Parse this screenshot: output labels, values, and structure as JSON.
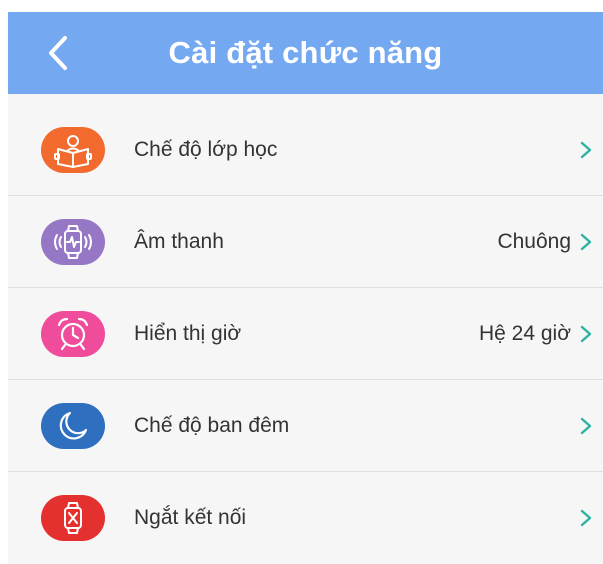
{
  "header": {
    "title": "Cài đặt chức năng",
    "background": "#74a9f2"
  },
  "items": [
    {
      "label": "Chế độ lớp học",
      "value": "",
      "icon": "reading-person-icon",
      "color": "#f26a2e"
    },
    {
      "label": "Âm thanh",
      "value": "Chuông",
      "icon": "vibrating-watch-icon",
      "color": "#9677c6"
    },
    {
      "label": "Hiển thị giờ",
      "value": "Hệ 24 giờ",
      "icon": "alarm-clock-icon",
      "color": "#ef4c9b"
    },
    {
      "label": "Chế độ ban đêm",
      "value": "",
      "icon": "moon-icon",
      "color": "#2e6fc0"
    },
    {
      "label": "Ngắt kết nối",
      "value": "",
      "icon": "disconnect-watch-icon",
      "color": "#e53030"
    }
  ],
  "chevron_color": "#2bb3a3"
}
